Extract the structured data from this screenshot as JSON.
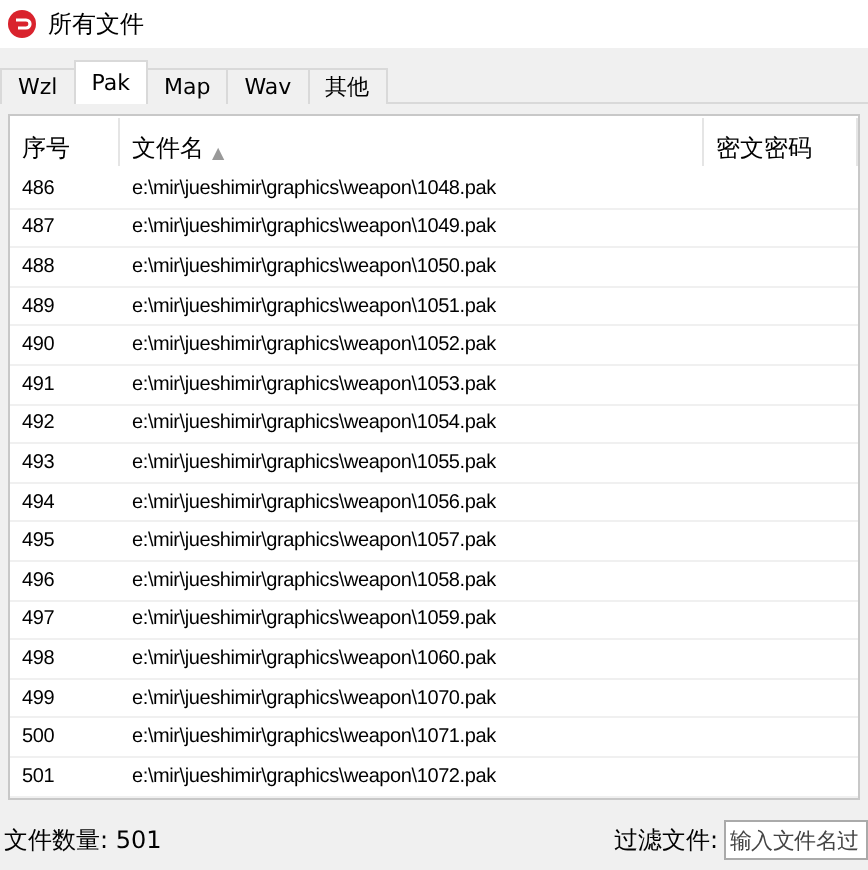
{
  "window": {
    "title": "所有文件"
  },
  "tabs": [
    {
      "label": "Wzl",
      "selected": false
    },
    {
      "label": "Pak",
      "selected": true
    },
    {
      "label": "Map",
      "selected": false
    },
    {
      "label": "Wav",
      "selected": false
    },
    {
      "label": "其他",
      "selected": false
    }
  ],
  "table": {
    "columns": [
      {
        "label": "序号"
      },
      {
        "label": "文件名",
        "sort": "▲"
      },
      {
        "label": "密文密码"
      }
    ],
    "rows": [
      [
        "486",
        "e:\\mir\\jueshimir\\graphics\\weapon\\1048.pak"
      ],
      [
        "487",
        "e:\\mir\\jueshimir\\graphics\\weapon\\1049.pak"
      ],
      [
        "488",
        "e:\\mir\\jueshimir\\graphics\\weapon\\1050.pak"
      ],
      [
        "489",
        "e:\\mir\\jueshimir\\graphics\\weapon\\1051.pak"
      ],
      [
        "490",
        "e:\\mir\\jueshimir\\graphics\\weapon\\1052.pak"
      ],
      [
        "491",
        "e:\\mir\\jueshimir\\graphics\\weapon\\1053.pak"
      ],
      [
        "492",
        "e:\\mir\\jueshimir\\graphics\\weapon\\1054.pak"
      ],
      [
        "493",
        "e:\\mir\\jueshimir\\graphics\\weapon\\1055.pak"
      ],
      [
        "494",
        "e:\\mir\\jueshimir\\graphics\\weapon\\1056.pak"
      ],
      [
        "495",
        "e:\\mir\\jueshimir\\graphics\\weapon\\1057.pak"
      ],
      [
        "496",
        "e:\\mir\\jueshimir\\graphics\\weapon\\1058.pak"
      ],
      [
        "497",
        "e:\\mir\\jueshimir\\graphics\\weapon\\1059.pak"
      ],
      [
        "498",
        "e:\\mir\\jueshimir\\graphics\\weapon\\1060.pak"
      ],
      [
        "499",
        "e:\\mir\\jueshimir\\graphics\\weapon\\1070.pak"
      ],
      [
        "500",
        "e:\\mir\\jueshimir\\graphics\\weapon\\1071.pak"
      ],
      [
        "501",
        "e:\\mir\\jueshimir\\graphics\\weapon\\1072.pak"
      ]
    ]
  },
  "status_bar": {
    "file_count": "文件数量: 501",
    "filter_label": "过滤文件:",
    "filter": {
      "placeholder": "输入文件名过"
    }
  }
}
